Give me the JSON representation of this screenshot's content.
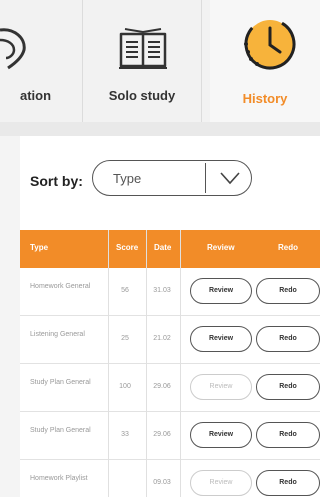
{
  "tabs": [
    {
      "label": "ation"
    },
    {
      "label": "Solo study"
    },
    {
      "label": "History"
    }
  ],
  "colors": {
    "accent": "#f28c28",
    "header_text": "#ffffff"
  },
  "sort": {
    "label": "Sort by:",
    "value": "Type"
  },
  "table": {
    "headers": {
      "type": "Type",
      "score": "Score",
      "date": "Date",
      "review": "Review",
      "redo": "Redo"
    },
    "rows": [
      {
        "type": "Homework General",
        "score": "56",
        "date": "31.03",
        "review": "Review",
        "redo": "Redo"
      },
      {
        "type": "Listening General",
        "score": "25",
        "date": "21.02",
        "review": "Review",
        "redo": "Redo"
      },
      {
        "type": "Study Plan General",
        "score": "100",
        "date": "29.06",
        "review": "Review",
        "redo": "Redo"
      },
      {
        "type": "Study Plan General",
        "score": "33",
        "date": "29.06",
        "review": "Review",
        "redo": "Redo"
      },
      {
        "type": "Homework Playlist",
        "score": "",
        "date": "09.03",
        "review": "Review",
        "redo": "Redo"
      }
    ]
  }
}
